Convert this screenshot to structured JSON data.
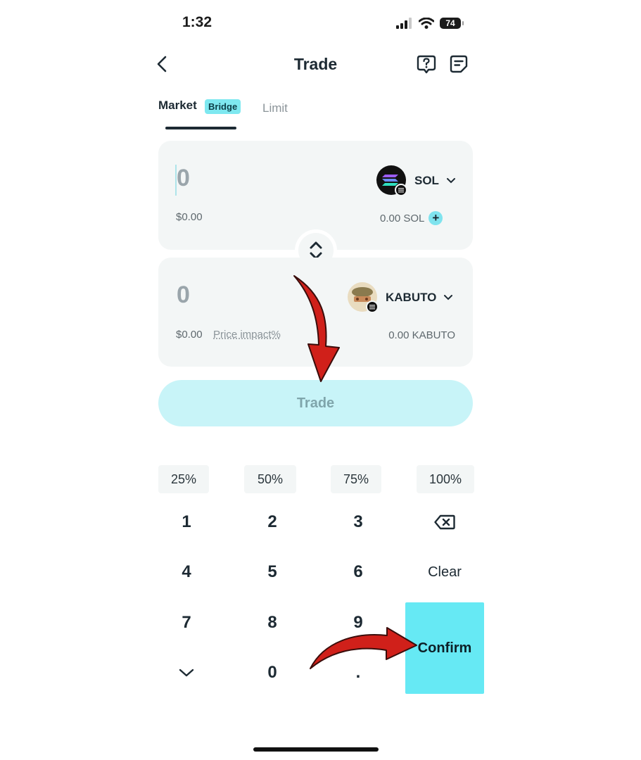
{
  "status": {
    "time": "1:32",
    "battery": "74"
  },
  "header": {
    "title": "Trade"
  },
  "tabs": {
    "market": "Market",
    "bridge_badge": "Bridge",
    "limit": "Limit"
  },
  "from": {
    "amount": "0",
    "usd": "$0.00",
    "token": "SOL",
    "balance": "0.00 SOL",
    "add": "+"
  },
  "to": {
    "amount": "0",
    "usd": "$0.00",
    "price_impact": "Price impact%",
    "token": "KABUTO",
    "balance": "0.00 KABUTO"
  },
  "trade_button": "Trade",
  "percent": [
    "25%",
    "50%",
    "75%",
    "100%"
  ],
  "keys": {
    "k1": "1",
    "k2": "2",
    "k3": "3",
    "k4": "4",
    "k5": "5",
    "k6": "6",
    "k7": "7",
    "k8": "8",
    "k9": "9",
    "k0": "0",
    "dot": ".",
    "clear": "Clear"
  },
  "confirm": "Confirm",
  "colors": {
    "accent": "#66e9f4",
    "trade_disabled": "#c8f4f8",
    "annotation_arrow": "#d0201a"
  },
  "icons": [
    "back-chevron-icon",
    "help-icon",
    "orders-icon",
    "swap-arrows-icon",
    "chevron-down-icon",
    "backspace-icon",
    "collapse-chevron-icon"
  ]
}
